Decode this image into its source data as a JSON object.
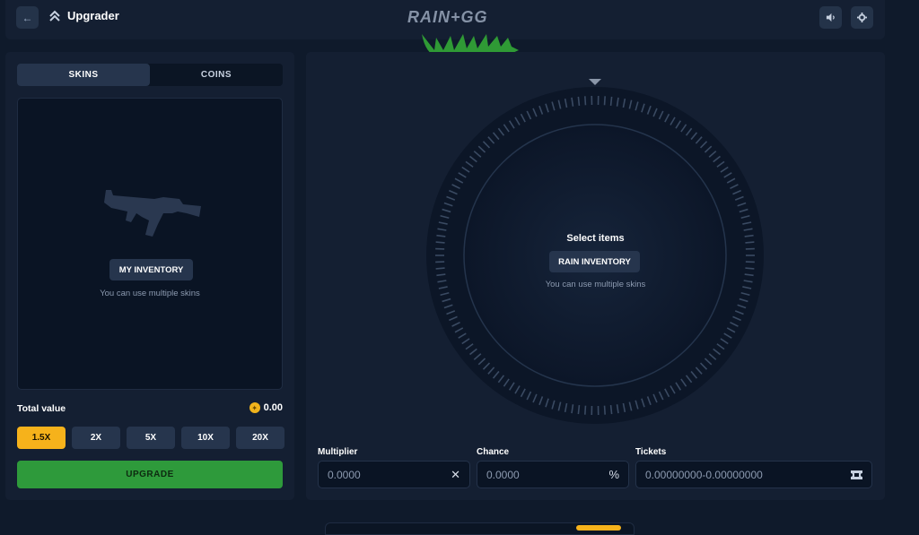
{
  "header": {
    "title": "Upgrader",
    "logo_text": "RAIN+GG",
    "back_icon": "arrow-left-icon",
    "page_icon": "chevrons-up-icon",
    "sound_icon": "speaker-icon",
    "settings_icon": "gear-icon"
  },
  "left": {
    "tabs": [
      {
        "label": "SKINS",
        "active": true
      },
      {
        "label": "COINS",
        "active": false
      }
    ],
    "inventory_button": "MY INVENTORY",
    "inventory_sub": "You can use multiple skins",
    "total_label": "Total value",
    "total_value": "0.00",
    "multipliers": [
      "1.5X",
      "2X",
      "5X",
      "10X",
      "20X"
    ],
    "active_multiplier": "1.5X",
    "upgrade_label": "UPGRADE"
  },
  "right": {
    "select_label": "Select items",
    "rain_button": "RAIN INVENTORY",
    "rain_sub": "You can use multiple skins",
    "fields": {
      "multiplier": {
        "label": "Multiplier",
        "value": "0.0000",
        "suffix": "✕"
      },
      "chance": {
        "label": "Chance",
        "value": "0.0000",
        "suffix": "%"
      },
      "tickets": {
        "label": "Tickets",
        "value": "0.00000000-0.00000000"
      }
    }
  },
  "colors": {
    "accent_yellow": "#f6b21b",
    "accent_green": "#2e9a3b",
    "panel": "#141f32",
    "background": "#0f1a2b"
  }
}
